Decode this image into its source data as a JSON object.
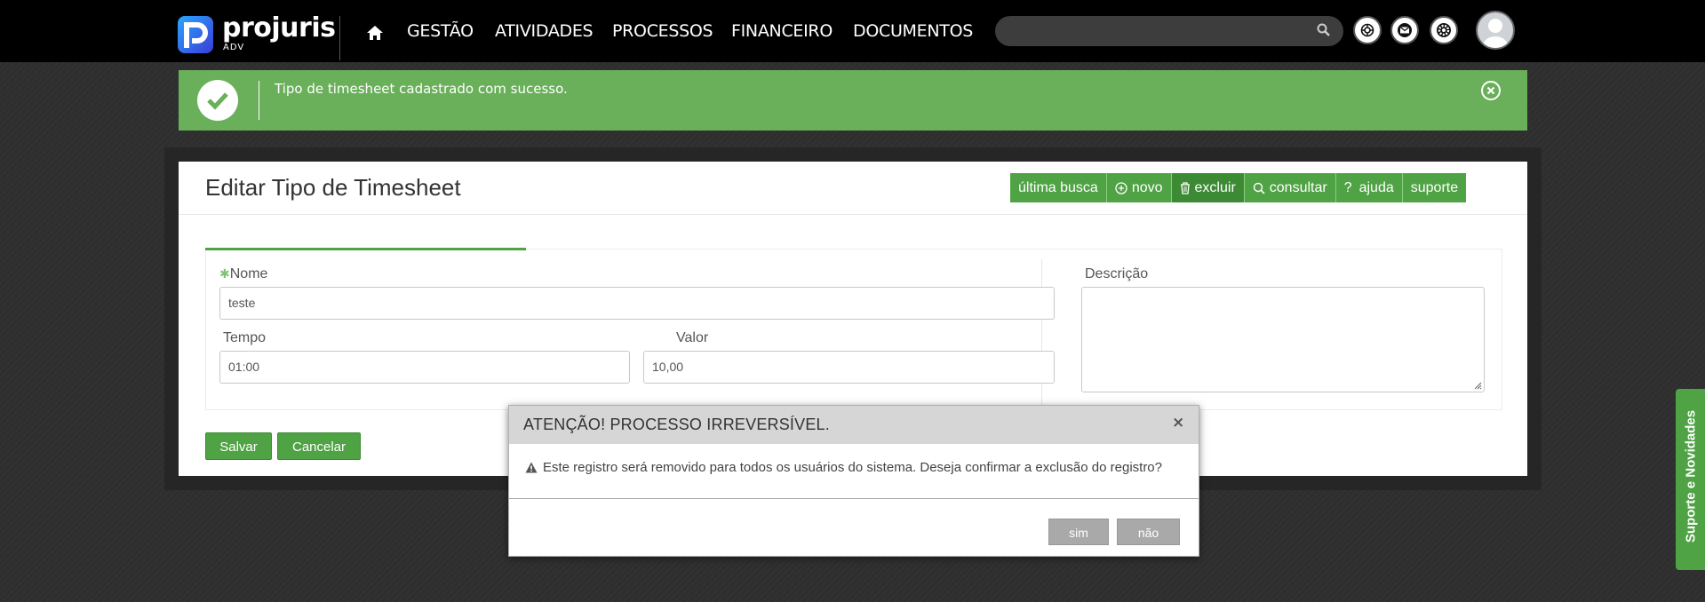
{
  "header": {
    "logo_brand": "projuris",
    "logo_sub": "ADV",
    "nav": [
      "GESTÃO",
      "ATIVIDADES",
      "PROCESSOS",
      "FINANCEIRO",
      "DOCUMENTOS"
    ],
    "search_placeholder": ""
  },
  "alert": {
    "message": "Tipo de timesheet cadastrado com sucesso.",
    "color": "#6ab05a"
  },
  "page": {
    "title": "Editar Tipo de Timesheet",
    "toolbar": [
      "última busca",
      "novo",
      "excluir",
      "consultar",
      "ajuda",
      "suporte"
    ]
  },
  "form": {
    "nome_label": "Nome",
    "nome_value": "teste",
    "tempo_label": "Tempo",
    "tempo_value": "01:00",
    "valor_label": "Valor",
    "valor_value": "10,00",
    "descricao_label": "Descrição",
    "descricao_value": "",
    "save_label": "Salvar",
    "cancel_label": "Cancelar"
  },
  "modal": {
    "title": "ATENÇÃO! PROCESSO IRREVERSÍVEL.",
    "close": "×",
    "message": "Este registro será removido para todos os usuários do sistema. Deseja confirmar a exclusão do registro?",
    "yes_label": "sim",
    "no_label": "não"
  },
  "sidetab": {
    "label": "Suporte e Novidades"
  },
  "colors": {
    "accent": "#4fa344",
    "header": "#000000",
    "background": "#2e2e2e"
  }
}
